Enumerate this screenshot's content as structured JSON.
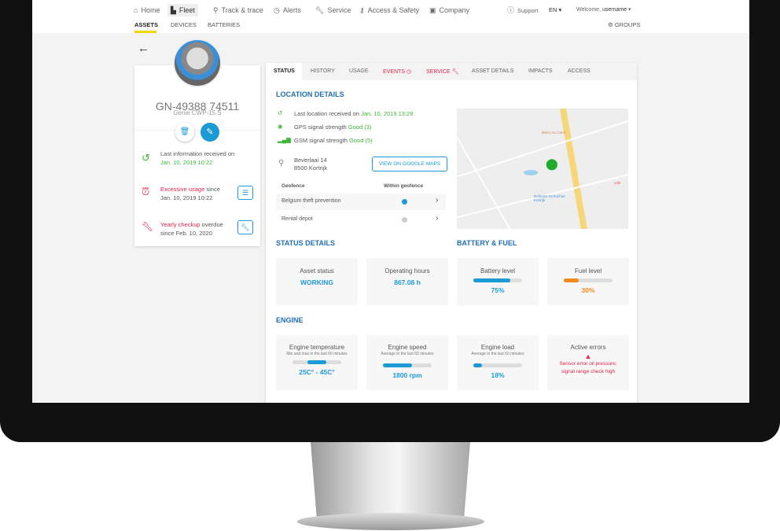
{
  "nav": {
    "items": [
      {
        "label": "Home",
        "icon": "home-icon"
      },
      {
        "label": "Fleet",
        "icon": "forklift-icon",
        "active": true
      },
      {
        "label": "Track & trace",
        "icon": "pin-icon"
      },
      {
        "label": "Alerts",
        "icon": "alarm-icon"
      },
      {
        "label": "Service",
        "icon": "wrench-icon"
      },
      {
        "label": "Access & Safety",
        "icon": "key-icon"
      },
      {
        "label": "Company",
        "icon": "badge-icon"
      }
    ],
    "support": "Support",
    "language": "EN",
    "welcome": "Welcome,",
    "username": "username"
  },
  "subnav": {
    "items": [
      "ASSETS",
      "DEVICES",
      "BATTERIES"
    ],
    "active": "ASSETS",
    "groups": "GROUPS",
    "accent": "#f2d600"
  },
  "asset": {
    "id": "GN-49388 74511",
    "model": "Genie CWP-15 S",
    "last_info": {
      "text": "Last information received on",
      "date": "Jan. 10, 2019 10:22"
    },
    "usage": {
      "highlight": "Excessive usage",
      "text": " since",
      "date": "Jan. 10, 2019 10:22"
    },
    "checkup": {
      "highlight": "Yearly checkup",
      "text": " overdue",
      "date": "since Feb. 10, 2020"
    }
  },
  "tabs": [
    "STATUS",
    "HISTORY",
    "USAGE",
    "EVENTS",
    "SERVICE",
    "ASSET DETAILS",
    "IMPACTS",
    "ACCESS"
  ],
  "location": {
    "heading": "LOCATION DETAILS",
    "last": "Last location received on ",
    "last_date": "Jan. 10, 2019 13:28",
    "gps": "GPS signal strength ",
    "gps_val": "Good (3)",
    "gsm": "GSM signal strength ",
    "gsm_val": "Good (5)",
    "address1": "Beverlaai 14",
    "address2": "8500 Kortrijk",
    "maps_button": "VIEW ON GOOGLE MAPS",
    "geofence_headers": [
      "Geofence",
      "Within geofence"
    ],
    "geofences": [
      {
        "name": "Belgium theft prevention",
        "within": true
      },
      {
        "name": "Rental depot",
        "within": false
      }
    ],
    "map_labels": [
      "Bistro Au Carré",
      "Delhaize St Rochus Kortrijk",
      "cafe"
    ]
  },
  "status": {
    "heading": "STATUS DETAILS",
    "asset_status_label": "Asset status",
    "asset_status": "WORKING",
    "hours_label": "Operating hours",
    "hours": "867.08 h"
  },
  "battery_fuel": {
    "heading": "BATTERY & FUEL",
    "battery_label": "Battery level",
    "battery": "75%",
    "battery_pct": 75,
    "fuel_label": "Fuel level",
    "fuel": "30%",
    "fuel_pct": 30,
    "fuel_color": "#f08a1c"
  },
  "engine": {
    "heading": "ENGINE",
    "temp_label": "Engine temperature",
    "temp_sub": "Min and max in the last 60 minutes",
    "temp": "25C° - 45C°",
    "temp_range": [
      30,
      70
    ],
    "speed_label": "Engine speed",
    "speed_sub": "Average in the last 60 minutes",
    "speed": "1800 rpm",
    "speed_pct": 60,
    "load_label": "Engine load",
    "load_sub": "Average in the last 60 minutes",
    "load": "18%",
    "load_pct": 18,
    "errors_label": "Active errors",
    "errors": "Sensor error oil pressure; signal range check high"
  }
}
